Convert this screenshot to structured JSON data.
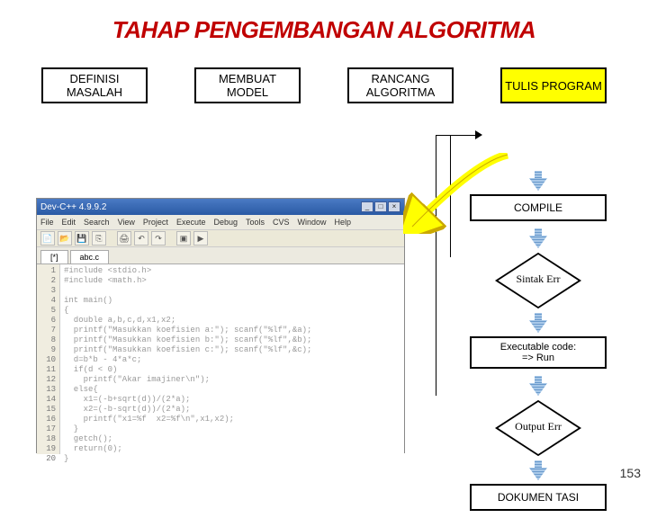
{
  "title": "TAHAP PENGEMBANGAN ALGORITMA",
  "top_boxes": [
    {
      "line1": "DEFINISI",
      "line2": "MASALAH"
    },
    {
      "line1": "MEMBUAT",
      "line2": "MODEL"
    },
    {
      "line1": "RANCANG",
      "line2": "ALGORITMA"
    },
    {
      "line1": "TULIS PROGRAM",
      "line2": ""
    }
  ],
  "flow": {
    "compile": "COMPILE",
    "sintak": "Sintak Err",
    "exec1": "Executable code:",
    "exec2": "=> Run",
    "output": "Output Err",
    "dok": "DOKUMEN TASI"
  },
  "ide": {
    "title": "Dev-C++ 4.9.9.2",
    "menu": [
      "File",
      "Edit",
      "Search",
      "View",
      "Project",
      "Execute",
      "Debug",
      "Tools",
      "CVS",
      "Window",
      "Help"
    ],
    "tabs": [
      "[*]",
      "abc.c"
    ],
    "code_lines": [
      "#include <stdio.h>",
      "#include <math.h>",
      "",
      "int main()",
      "{",
      "  double a,b,c,d,x1,x2;",
      "  printf(\"Masukkan koefisien a:\"); scanf(\"%lf\",&a);",
      "  printf(\"Masukkan koefisien b:\"); scanf(\"%lf\",&b);",
      "  printf(\"Masukkan koefisien c:\"); scanf(\"%lf\",&c);",
      "  d=b*b - 4*a*c;",
      "  if(d < 0)",
      "    printf(\"Akar imajiner\\n\");",
      "  else{",
      "    x1=(-b+sqrt(d))/(2*a);",
      "    x2=(-b-sqrt(d))/(2*a);",
      "    printf(\"x1=%f  x2=%f\\n\",x1,x2);",
      "  }",
      "  getch();",
      "  return(0);",
      "}"
    ],
    "gutter_count": 20
  },
  "page_number": "153"
}
